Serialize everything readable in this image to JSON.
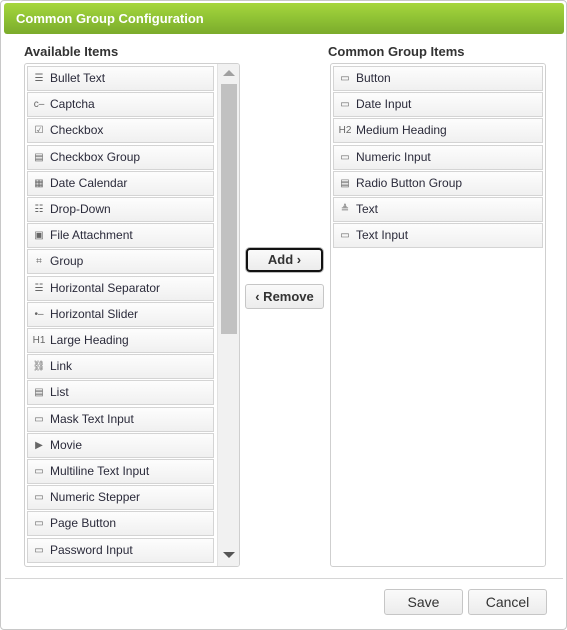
{
  "dialog": {
    "title": "Common Group Configuration",
    "accent_color": "#8fc234"
  },
  "available": {
    "label": "Available Items",
    "items": [
      {
        "label": "Bullet Text",
        "icon": "bullet-list-icon",
        "glyph": "☰"
      },
      {
        "label": "Captcha",
        "icon": "captcha-icon",
        "glyph": "c–"
      },
      {
        "label": "Checkbox",
        "icon": "checkbox-icon",
        "glyph": "☑"
      },
      {
        "label": "Checkbox Group",
        "icon": "checkbox-group-icon",
        "glyph": "▤"
      },
      {
        "label": "Date Calendar",
        "icon": "calendar-icon",
        "glyph": "▦"
      },
      {
        "label": "Drop-Down",
        "icon": "dropdown-icon",
        "glyph": "☷"
      },
      {
        "label": "File Attachment",
        "icon": "image-icon",
        "glyph": "▣"
      },
      {
        "label": "Group",
        "icon": "group-icon",
        "glyph": "⌗"
      },
      {
        "label": "Horizontal Separator",
        "icon": "separator-icon",
        "glyph": "☱"
      },
      {
        "label": "Horizontal Slider",
        "icon": "slider-icon",
        "glyph": "•–"
      },
      {
        "label": "Large Heading",
        "icon": "heading-h1-icon",
        "glyph": "H1"
      },
      {
        "label": "Link",
        "icon": "link-icon",
        "glyph": "⛓"
      },
      {
        "label": "List",
        "icon": "list-icon",
        "glyph": "▤"
      },
      {
        "label": "Mask Text Input",
        "icon": "mask-input-icon",
        "glyph": "▭"
      },
      {
        "label": "Movie",
        "icon": "movie-icon",
        "glyph": "▶"
      },
      {
        "label": "Multiline Text Input",
        "icon": "multiline-input-icon",
        "glyph": "▭"
      },
      {
        "label": "Numeric Stepper",
        "icon": "stepper-icon",
        "glyph": "▭"
      },
      {
        "label": "Page Button",
        "icon": "page-button-icon",
        "glyph": "▭"
      },
      {
        "label": "Password Input",
        "icon": "password-input-icon",
        "glyph": "▭"
      }
    ]
  },
  "selected": {
    "label": "Common Group Items",
    "items": [
      {
        "label": "Button",
        "icon": "button-icon",
        "glyph": "▭"
      },
      {
        "label": "Date Input",
        "icon": "date-input-icon",
        "glyph": "▭"
      },
      {
        "label": "Medium Heading",
        "icon": "heading-h2-icon",
        "glyph": "H2"
      },
      {
        "label": "Numeric Input",
        "icon": "numeric-input-icon",
        "glyph": "▭"
      },
      {
        "label": "Radio Button Group",
        "icon": "radio-group-icon",
        "glyph": "▤"
      },
      {
        "label": "Text",
        "icon": "text-icon",
        "glyph": "≜"
      },
      {
        "label": "Text Input",
        "icon": "text-input-icon",
        "glyph": "▭"
      }
    ]
  },
  "actions": {
    "add": "Add ›",
    "remove": "‹ Remove"
  },
  "footer": {
    "save": "Save",
    "cancel": "Cancel"
  }
}
